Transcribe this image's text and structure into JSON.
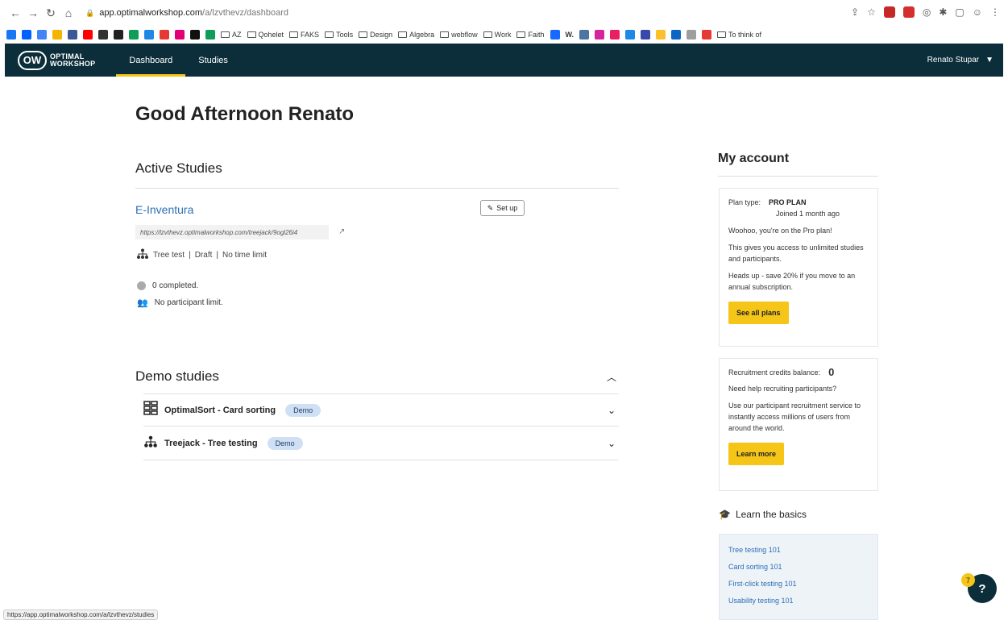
{
  "browser": {
    "nav_icons": [
      "back-icon",
      "forward-icon",
      "reload-icon",
      "home-icon"
    ],
    "address_host": "app.optimalworkshop.com",
    "address_path": "/a/lzvthevz/dashboard",
    "bookmarks": [
      "AZ",
      "Qohelet",
      "FAKS",
      "Tools",
      "Design",
      "Algebra",
      "webflow",
      "Work",
      "Faith",
      "W.",
      "To think of"
    ],
    "status_url": "https://app.optimalworkshop.com/a/lzvthevz/studies"
  },
  "header": {
    "logo_mark": "OW",
    "logo_line1": "OPTIMAL",
    "logo_line2": "WORKSHOP",
    "tabs": [
      {
        "label": "Dashboard",
        "active": true
      },
      {
        "label": "Studies",
        "active": false
      }
    ],
    "user_name": "Renato Stupar"
  },
  "main": {
    "greeting": "Good Afternoon Renato",
    "active_studies_title": "Active Studies",
    "study": {
      "name": "E-Inventura",
      "setup_label": "Set up",
      "url": "https://lzvthevz.optimalworkshop.com/treejack/9ogl26i4",
      "type": "Tree test",
      "status": "Draft",
      "time_limit": "No time limit",
      "separator": "|",
      "completed": "0 completed.",
      "participant_limit": "No participant limit."
    },
    "demo_title": "Demo studies",
    "demos": [
      {
        "label": "OptimalSort - Card sorting",
        "badge": "Demo"
      },
      {
        "label": "Treejack - Tree testing",
        "badge": "Demo"
      }
    ]
  },
  "sidebar": {
    "title": "My account",
    "plan_label": "Plan type:",
    "plan_value": "PRO PLAN",
    "joined": "Joined 1 month ago",
    "plan_text1": "Woohoo, you're on the Pro plan!",
    "plan_text2": "This gives you access to unlimited studies and participants.",
    "plan_text3": "Heads up - save 20% if you move to an annual subscription.",
    "plans_button": "See all plans",
    "credits_label": "Recruitment credits balance:",
    "credits_value": "0",
    "credits_text1": "Need help recruiting participants?",
    "credits_text2": "Use our participant recruitment service to instantly access millions of users from around the world.",
    "learn_more_button": "Learn more",
    "learn_title": "Learn the basics",
    "learn_links": [
      "Tree testing 101",
      "Card sorting 101",
      "First-click testing 101",
      "Usability testing 101"
    ]
  },
  "help": {
    "label": "?",
    "badge": "7"
  },
  "colors": {
    "header_bg": "#0b2e3a",
    "accent": "#f5c518",
    "link": "#2a6fb6",
    "badge_bg": "#cfe0f5"
  }
}
